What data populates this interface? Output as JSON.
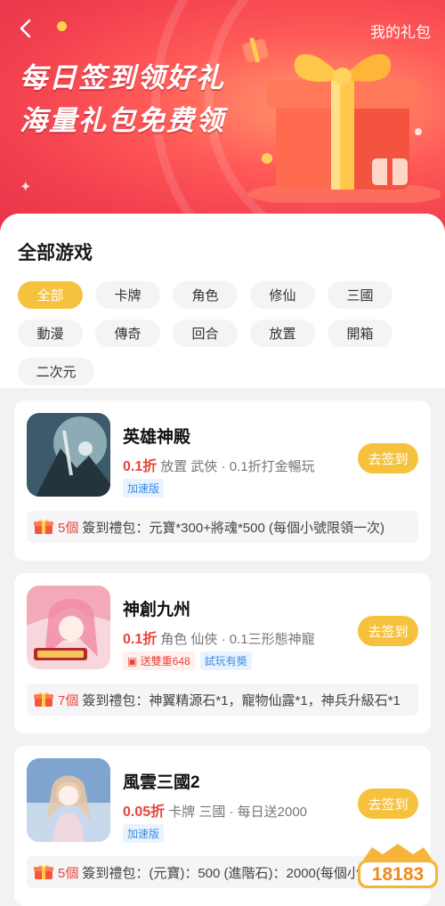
{
  "header": {
    "back": "<",
    "my_gifts": "我的礼包",
    "title_line1": "每日签到领好礼",
    "title_line2": "海量礼包免费领"
  },
  "filters": {
    "title": "全部游戏",
    "chips": [
      "全部",
      "卡牌",
      "角色",
      "修仙",
      "三國",
      "動漫",
      "傳奇",
      "回合",
      "放置",
      "開箱",
      "二次元"
    ],
    "active": "全部"
  },
  "games": [
    {
      "name": "英雄神殿",
      "discount": "0.1折",
      "meta": "放置  武俠 · 0.1折打金暢玩",
      "tags": [
        {
          "text": "加速版",
          "style": "blue"
        }
      ],
      "button": "去签到",
      "gift_count": "5個",
      "gift_text": "簽到禮包：元寶*300+將魂*500 (每個小號限領一次)",
      "icon_colors": [
        "#3d5a6a",
        "#a7c7cf"
      ]
    },
    {
      "name": "神創九州",
      "discount": "0.1折",
      "meta": "角色  仙俠 · 0.1三形態神寵",
      "tags": [
        {
          "text": "送雙重648",
          "style": "red"
        },
        {
          "text": "試玩有奬",
          "style": "blue"
        }
      ],
      "button": "去签到",
      "gift_count": "7個",
      "gift_text": "簽到禮包：神翼精源石*1，寵物仙露*1，神兵升級石*1",
      "icon_colors": [
        "#f4a9b8",
        "#f7d6dc"
      ]
    },
    {
      "name": "風雲三國2",
      "discount": "0.05折",
      "meta": "卡牌  三國 · 每日送2000",
      "tags": [
        {
          "text": "加速版",
          "style": "blue"
        }
      ],
      "button": "去签到",
      "gift_count": "5個",
      "gift_text": "簽到禮包：(元寶)：500 (進階石)：2000(每個小號",
      "icon_colors": [
        "#7fa4cf",
        "#efd8df"
      ]
    }
  ],
  "watermark": "18183",
  "colors": {
    "accent": "#f6c23e",
    "discount": "#e8453c",
    "banner": "#f2404f"
  }
}
